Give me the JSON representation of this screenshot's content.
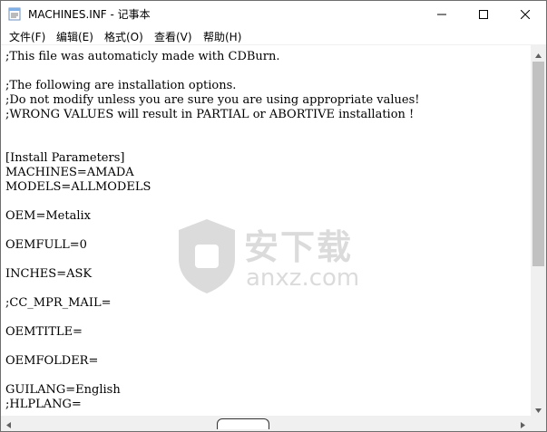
{
  "window": {
    "title": "MACHINES.INF - 记事本"
  },
  "menu": {
    "items": [
      {
        "label": "文件(F)"
      },
      {
        "label": "编辑(E)"
      },
      {
        "label": "格式(O)"
      },
      {
        "label": "查看(V)"
      },
      {
        "label": "帮助(H)"
      }
    ]
  },
  "editor": {
    "lines": [
      ";This file was automaticly made with CDBurn.",
      "",
      ";The following are installation options.",
      ";Do not modify unless you are sure you are using appropriate values!",
      ";WRONG VALUES will result in PARTIAL or ABORTIVE installation !",
      "",
      "",
      "[Install Parameters]",
      "MACHINES=AMADA",
      "MODELS=ALLMODELS",
      "",
      "OEM=Metalix",
      "",
      "OEMFULL=0",
      "",
      "INCHES=ASK",
      "",
      ";CC_MPR_MAIL=",
      "",
      "OEMTITLE=",
      "",
      "OEMFOLDER=",
      "",
      "GUILANG=English",
      ";HLPLANG="
    ]
  },
  "watermark": {
    "logo_text": "安下载",
    "domain_text": "anxz.com"
  },
  "icons": {
    "app": "notepad-icon",
    "minimize": "minimize-icon",
    "maximize": "maximize-icon",
    "close": "close-icon"
  }
}
